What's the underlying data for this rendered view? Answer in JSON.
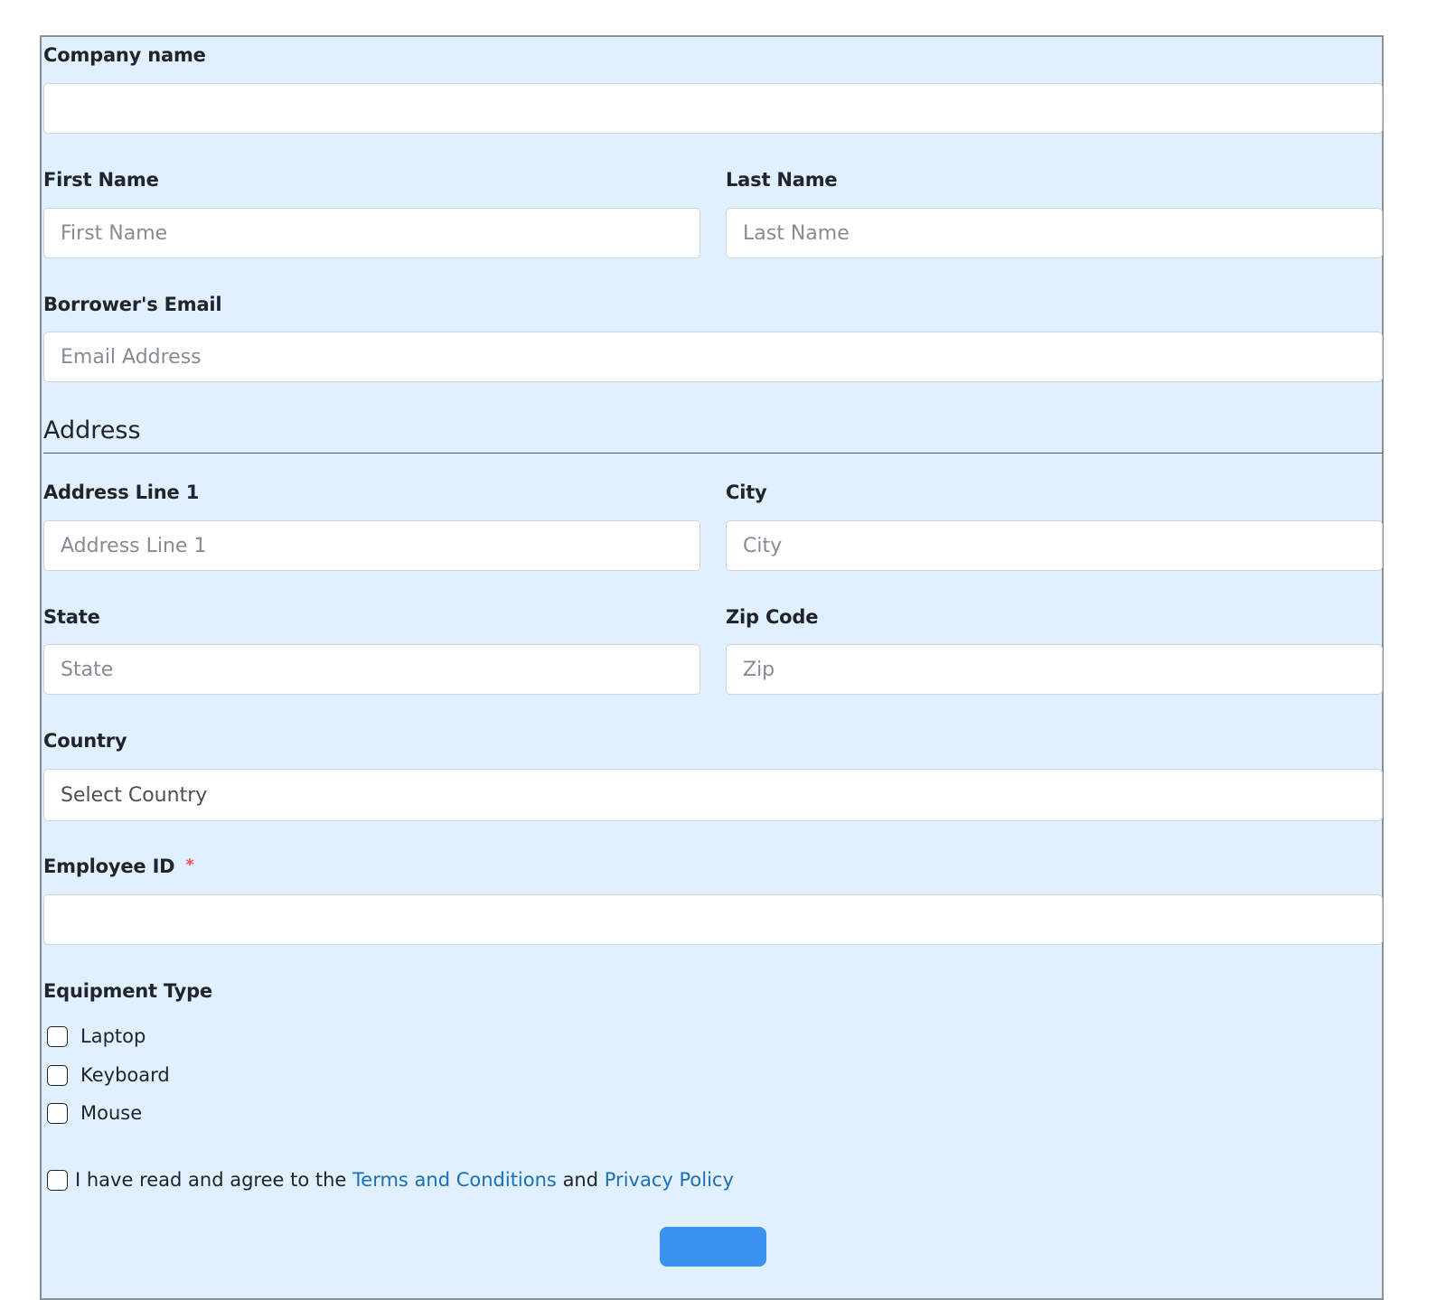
{
  "form": {
    "company_name": {
      "label": "Company name",
      "value": "",
      "placeholder": ""
    },
    "first_name": {
      "label": "First Name",
      "value": "",
      "placeholder": "First Name"
    },
    "last_name": {
      "label": "Last Name",
      "value": "",
      "placeholder": "Last Name"
    },
    "email": {
      "label": "Borrower's Email",
      "value": "",
      "placeholder": "Email Address"
    },
    "address_section": {
      "heading": "Address"
    },
    "address_line1": {
      "label": "Address Line 1",
      "value": "",
      "placeholder": "Address Line 1"
    },
    "city": {
      "label": "City",
      "value": "",
      "placeholder": "City"
    },
    "state": {
      "label": "State",
      "value": "",
      "placeholder": "State"
    },
    "zip": {
      "label": "Zip Code",
      "value": "",
      "placeholder": "Zip"
    },
    "country": {
      "label": "Country",
      "selected": "Select Country"
    },
    "employee_id": {
      "label": "Employee ID",
      "required_marker": "*",
      "value": "",
      "placeholder": ""
    },
    "equipment_type": {
      "label": "Equipment Type",
      "options": [
        {
          "label": "Laptop",
          "checked": false
        },
        {
          "label": "Keyboard",
          "checked": false
        },
        {
          "label": "Mouse",
          "checked": false
        }
      ]
    },
    "terms": {
      "checked": false,
      "prefix": "I have read and agree to the",
      "terms_link": "Terms and Conditions",
      "conjunction": "and",
      "privacy_link": "Privacy Policy"
    },
    "submit": {
      "label": ""
    }
  },
  "colors": {
    "background": "#e0f0fe",
    "link": "#1a6fb8",
    "required": "#f0505a",
    "button": "#3b92f0"
  }
}
